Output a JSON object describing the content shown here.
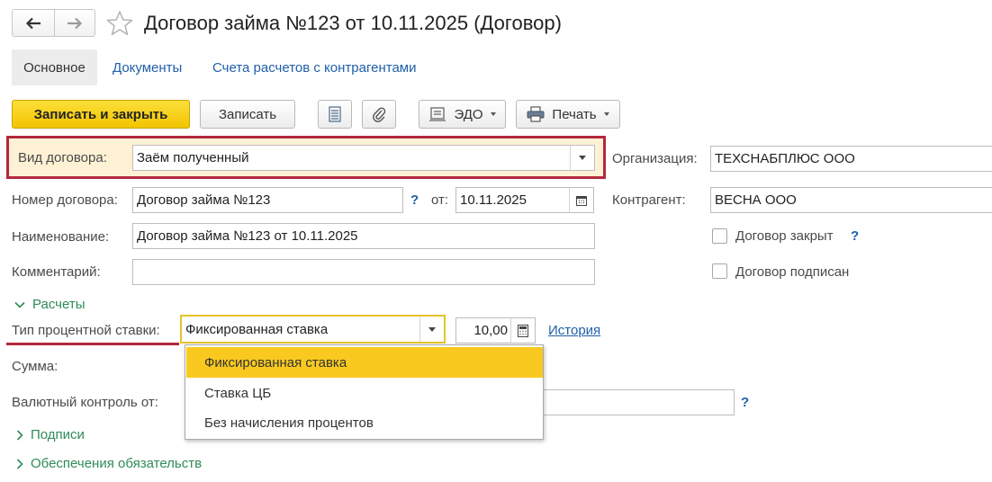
{
  "window": {
    "title": "Договор займа №123 от 10.11.2025 (Договор)"
  },
  "tabs": [
    {
      "label": "Основное",
      "active": true
    },
    {
      "label": "Документы",
      "active": false
    },
    {
      "label": "Счета расчетов с контрагентами",
      "active": false
    }
  ],
  "toolbar": {
    "save_close_label": "Записать и закрыть",
    "save_label": "Записать",
    "edo_label": "ЭДО",
    "print_label": "Печать"
  },
  "form": {
    "contract_type": {
      "label": "Вид договора:",
      "value": "Заём полученный"
    },
    "organization": {
      "label": "Организация:",
      "value": "ТЕХСНАБПЛЮС ООО"
    },
    "contract_number": {
      "label": "Номер договора:",
      "value": "Договор займа №123",
      "help": "?"
    },
    "date": {
      "label": "от:",
      "value": "10.11.2025"
    },
    "counterparty": {
      "label": "Контрагент:",
      "value": "ВЕСНА ООО"
    },
    "name": {
      "label": "Наименование:",
      "value": "Договор займа №123 от 10.11.2025"
    },
    "comment": {
      "label": "Комментарий:",
      "value": ""
    },
    "contract_closed": {
      "label": "Договор закрыт",
      "checked": false,
      "help": "?"
    },
    "contract_signed": {
      "label": "Договор подписан",
      "checked": false
    },
    "section_settlements": "Расчеты",
    "rate_type": {
      "label": "Тип процентной ставки:",
      "value": "Фиксированная ставка"
    },
    "rate_value": "10,00",
    "history_link": "История",
    "sum": {
      "label": "Сумма:"
    },
    "currency_control": {
      "label": "Валютный контроль от:",
      "help": "?"
    },
    "section_signatures": "Подписи",
    "section_obligations": "Обеспечения обязательств"
  },
  "dropdown": {
    "options": [
      "Фиксированная ставка",
      "Ставка ЦБ",
      "Без начисления процентов"
    ],
    "selected_index": 0
  },
  "colors": {
    "primary_button": "#f5c800",
    "highlight_border": "#b3283d",
    "link": "#1f5fa8",
    "section": "#2e8b57",
    "selected_option": "#f9c91f"
  }
}
